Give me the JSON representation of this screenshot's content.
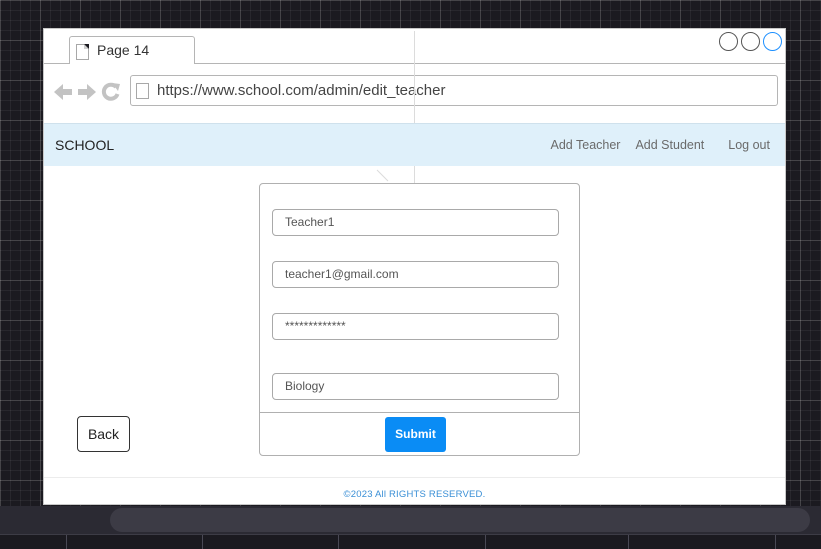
{
  "browser": {
    "tab_title": "Page 14",
    "url": "https://www.school.com/admin/edit_teacher"
  },
  "navbar": {
    "brand": "SCHOOL",
    "links": [
      "Add Teacher",
      "Add Student",
      "Log out"
    ]
  },
  "form": {
    "name_value": "Teacher1",
    "email_value": "teacher1@gmail.com",
    "password_value": "*************",
    "subject_value": "Biology",
    "submit_label": "Submit"
  },
  "back_label": "Back",
  "footer": {
    "copyright": "©2023 All RIGHTS RESERVED."
  },
  "colors": {
    "navbar_bg": "#dff0fa",
    "submit_bg": "#0a8cf5",
    "copyright_text": "#3a8fd6"
  }
}
